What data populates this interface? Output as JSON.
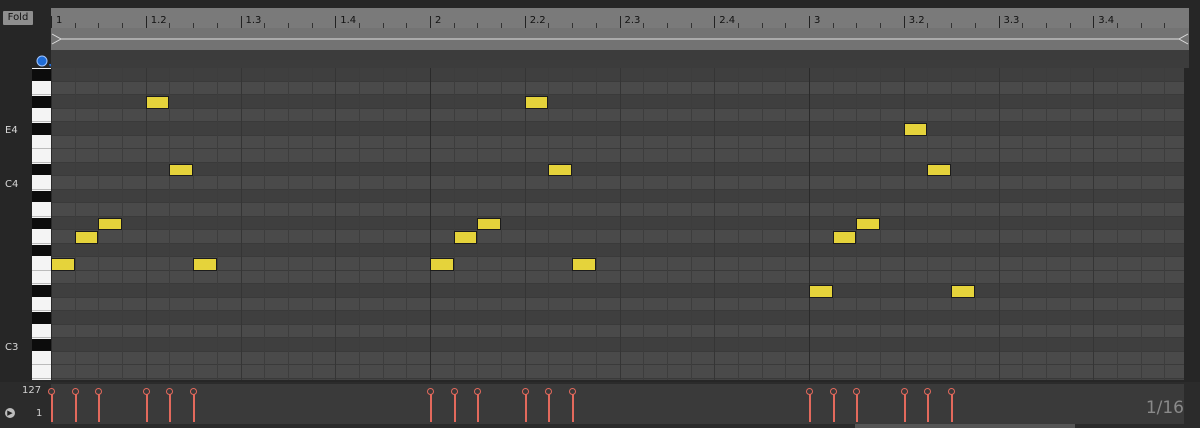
{
  "fold_label": "Fold",
  "ruler_ticks": [
    "1",
    "1.2",
    "1.3",
    "1.4",
    "2",
    "2.2",
    "2.3",
    "2.4",
    "3",
    "3.2",
    "3.3",
    "3.4"
  ],
  "note_labels": [
    "E4",
    "C4",
    "C3"
  ],
  "velocity": {
    "max_label": "127",
    "min_label": "1"
  },
  "quantize_label": "1/16",
  "colors": {
    "note": "#e5d33b",
    "velocity": "#e3695c",
    "bar_line": "#2a2a2a"
  },
  "notes": [
    {
      "beat": 0.0,
      "row": 14
    },
    {
      "beat": 0.25,
      "row": 12
    },
    {
      "beat": 0.5,
      "row": 11
    },
    {
      "beat": 1.0,
      "row": 2
    },
    {
      "beat": 1.25,
      "row": 7
    },
    {
      "beat": 1.5,
      "row": 14
    },
    {
      "beat": 4.0,
      "row": 14
    },
    {
      "beat": 4.25,
      "row": 12
    },
    {
      "beat": 4.5,
      "row": 11
    },
    {
      "beat": 5.0,
      "row": 2
    },
    {
      "beat": 5.25,
      "row": 7
    },
    {
      "beat": 5.5,
      "row": 14
    },
    {
      "beat": 8.0,
      "row": 16
    },
    {
      "beat": 8.25,
      "row": 12
    },
    {
      "beat": 8.5,
      "row": 11
    },
    {
      "beat": 9.0,
      "row": 4
    },
    {
      "beat": 9.25,
      "row": 7
    },
    {
      "beat": 9.5,
      "row": 16
    }
  ]
}
